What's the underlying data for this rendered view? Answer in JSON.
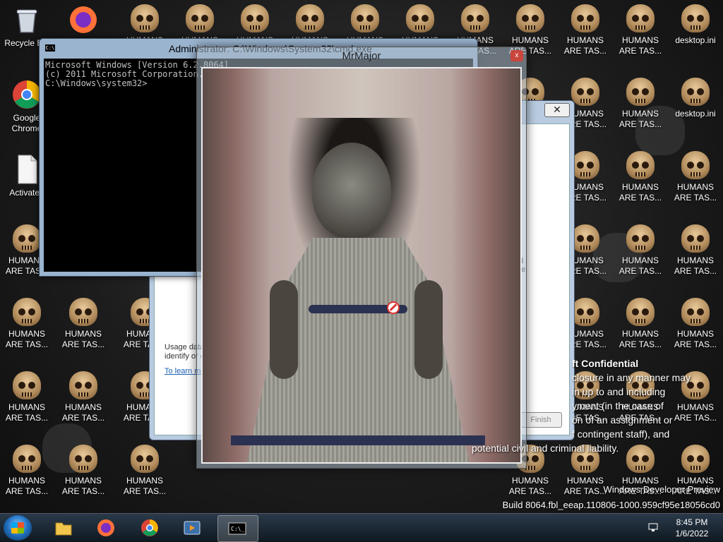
{
  "desktop": {
    "left_icons": [
      {
        "label": "Recycle Bin",
        "type": "recycle"
      },
      {
        "label": "Google Chrome",
        "type": "chrome"
      },
      {
        "label": "Activated",
        "type": "file"
      }
    ],
    "skull_label": "HUMANS ARE TAS...",
    "ini_label": "desktop.ini"
  },
  "cmd_window": {
    "title": "Administrator: C:\\Windows\\System32\\cmd.exe",
    "lines": [
      "Microsoft Windows [Version 6.2.8064]",
      "(c) 2011 Microsoft Corporation. All rights reserved.",
      "",
      "C:\\Windows\\system32>"
    ]
  },
  "mr_major_window": {
    "title": "MrMajor",
    "close_label": "x"
  },
  "background_dialog": {
    "close_label": "✕",
    "usage_text": "Usage data will be sent to Microsoft...",
    "identify_text": "identify or contact you.",
    "learn_more_link": "To learn more...",
    "finish_label": "Finish",
    "side_text_1": "ad",
    "side_text_2": "the"
  },
  "confidential_overlay": {
    "heading": "ft Confidential",
    "lines": [
      "closure in any manner may",
      "in up to and including",
      "yment (in the case of",
      "on of an assignment or",
      "f contingent staff), and",
      "potential civil and criminal liability."
    ]
  },
  "build_info": {
    "line1": "Windows Developer Preview",
    "line2": "Build 8064.fbl_eeap.110806-1000.959cf95e18056cd0"
  },
  "taskbar": {
    "buttons": [
      "file-explorer",
      "firefox",
      "chrome",
      "media-player",
      "cmd"
    ],
    "clock_time": "8:45 PM",
    "clock_date": "1/6/2022"
  },
  "colors": {
    "taskbar": "#1a2633",
    "accent_blue": "#1a5fb4",
    "close_red": "#c9463d"
  }
}
